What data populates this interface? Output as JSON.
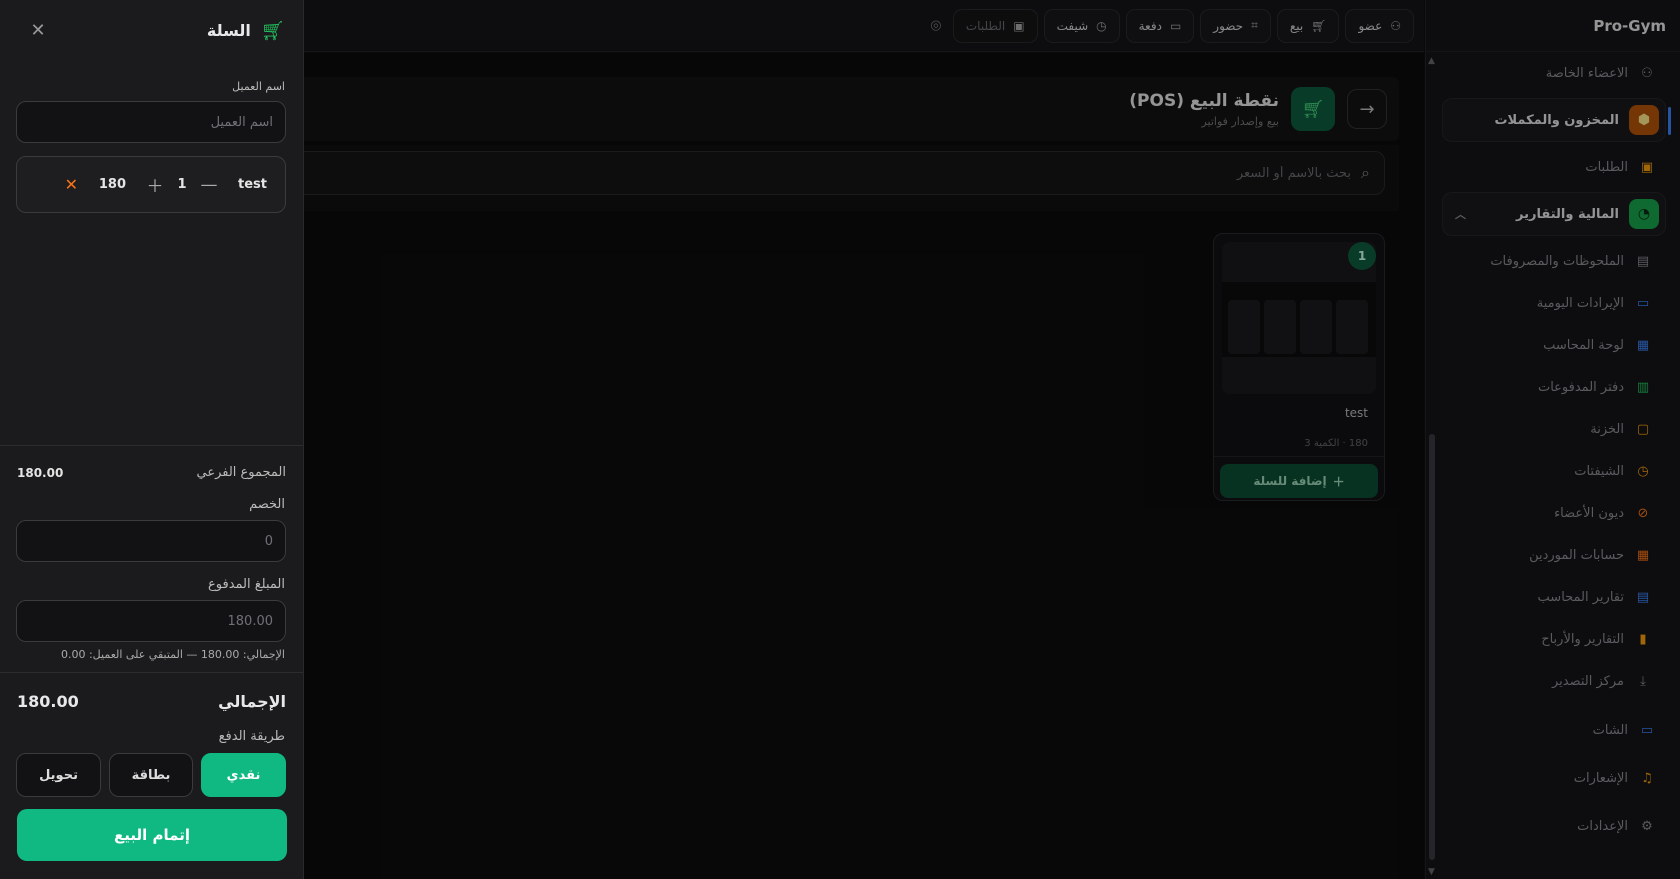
{
  "app": {
    "brand": "Pro-Gym"
  },
  "sidebar": {
    "items_top": [
      {
        "label": "الاعضاء الخاصة",
        "icon": "user-icon"
      }
    ],
    "group_inventory": {
      "label": "المخزون والمكملات",
      "icon": "box-icon",
      "color": "#f59e0b"
    },
    "item_orders": {
      "label": "الطلبات",
      "icon": "bag-icon"
    },
    "group_finance": {
      "label": "المالية والتقارير",
      "icon": "chart-pie-icon",
      "color": "#22c55e"
    },
    "finance_items": [
      {
        "label": "الملحوظات والمصروفات",
        "icon": "file-icon"
      },
      {
        "label": "الإيرادات اليومية",
        "icon": "money-icon"
      },
      {
        "label": "لوحة المحاسب",
        "icon": "grid-icon"
      },
      {
        "label": "دفتر المدفوعات",
        "icon": "ledger-icon"
      },
      {
        "label": "الخزنة",
        "icon": "wallet-icon"
      },
      {
        "label": "الشيفتات",
        "icon": "clock-icon"
      },
      {
        "label": "ديون الأعضاء",
        "icon": "debt-icon"
      },
      {
        "label": "حسابات الموردين",
        "icon": "store-icon"
      },
      {
        "label": "تقارير المحاسب",
        "icon": "report-icon"
      },
      {
        "label": "التقارير والأرباح",
        "icon": "bar-chart-icon"
      },
      {
        "label": "مركز التصدير",
        "icon": "download-icon"
      }
    ],
    "items_bottom": [
      {
        "label": "الشات",
        "icon": "chat-icon"
      },
      {
        "label": "الإشعارات",
        "icon": "bell-icon"
      },
      {
        "label": "الإعدادات",
        "icon": "gear-icon"
      }
    ]
  },
  "topbar": {
    "actions": [
      {
        "label": "عضو",
        "icon": "user-plus-icon"
      },
      {
        "label": "بيع",
        "icon": "cart-icon"
      },
      {
        "label": "حضور",
        "icon": "scan-icon"
      },
      {
        "label": "دفعة",
        "icon": "money-icon"
      },
      {
        "label": "شيفت",
        "icon": "clock-icon"
      },
      {
        "label": "الطلبات",
        "icon": "bag-icon"
      }
    ]
  },
  "pos": {
    "title": "نقطة البيع (POS)",
    "subtitle": "بيع وإصدار فواتير",
    "search_placeholder": "بحث بالاسم أو السعر"
  },
  "product": {
    "count": "1",
    "name": "test",
    "meta": "180 · الكمية 3",
    "add_label": "إضافة للسلة"
  },
  "cart": {
    "title": "السلة",
    "customer_label": "اسم العميل",
    "customer_placeholder": "اسم العميل",
    "line": {
      "name": "test",
      "qty": "1",
      "price": "180"
    },
    "subtotal_label": "المجموع الفرعي",
    "subtotal_value": "180.00",
    "discount_label": "الخصم",
    "discount_placeholder": "0",
    "paid_label": "المبلغ المدفوع",
    "paid_placeholder": "180.00",
    "summary_note": "الإجمالي: 180.00 — المتبقي على العميل: 0.00",
    "total_label": "الإجمالي",
    "total_value": "180.00",
    "payment_method_label": "طريقة الدفع",
    "methods": [
      {
        "label": "نقدي",
        "active": true
      },
      {
        "label": "بطاقة",
        "active": false
      },
      {
        "label": "تحويل",
        "active": false
      }
    ],
    "complete_label": "إتمام البيع"
  }
}
